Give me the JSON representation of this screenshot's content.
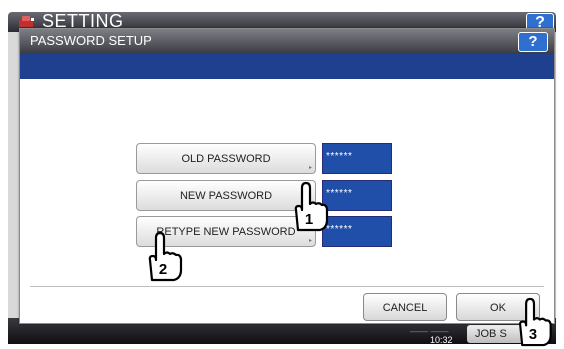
{
  "background": {
    "title": "SETTING",
    "help_label": "?",
    "time_top": "—— ——",
    "time": "10:32",
    "job_label": "JOB S"
  },
  "dialog": {
    "title": "PASSWORD SETUP",
    "help_label": "?",
    "fields": [
      {
        "label": "OLD PASSWORD",
        "value": "******"
      },
      {
        "label": "NEW PASSWORD",
        "value": "******"
      },
      {
        "label": "RETYPE NEW PASSWORD",
        "value": "******"
      }
    ],
    "cancel_label": "CANCEL",
    "ok_label": "OK"
  },
  "callouts": [
    "1",
    "2",
    "3"
  ],
  "icons": {
    "logo": "setting-logo-icon",
    "field_arrow": "▸",
    "hand": "pointing-hand-icon"
  },
  "colors": {
    "value_box": "#1f4fa8",
    "title_band": "#1f3f8f",
    "help_button": "#2f6fd0"
  }
}
